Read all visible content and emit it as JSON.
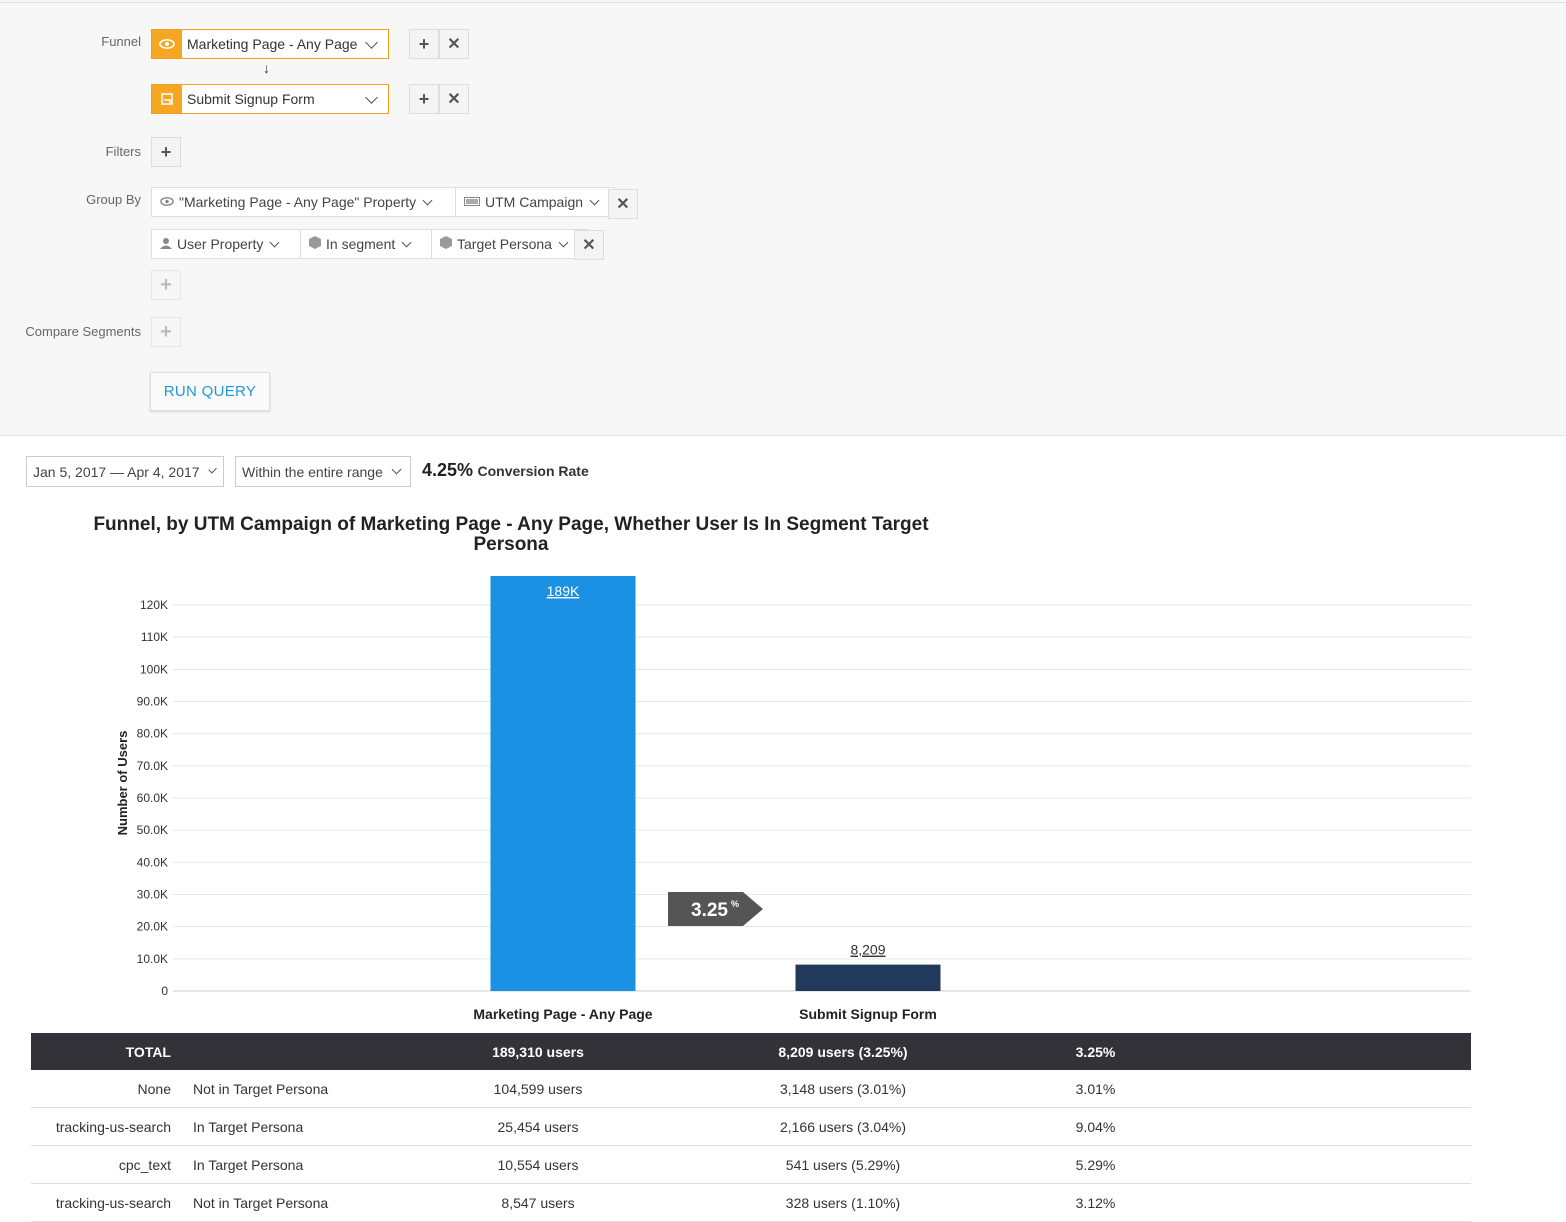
{
  "query": {
    "funnel_label": "Funnel",
    "steps": [
      {
        "label": "Marketing Page - Any Page",
        "icon": "eye-icon"
      },
      {
        "label": "Submit Signup Form",
        "icon": "form-icon"
      }
    ],
    "filters_label": "Filters",
    "group_by_label": "Group By",
    "group_by": [
      [
        {
          "label": "\"Marketing Page - Any Page\" Property",
          "icon": "eye-icon"
        },
        {
          "label": "UTM Campaign",
          "icon": "utm-icon"
        }
      ],
      [
        {
          "label": "User Property",
          "icon": "user-icon"
        },
        {
          "label": "In segment",
          "icon": "segment-icon"
        },
        {
          "label": "Target Persona",
          "icon": "segment-icon"
        }
      ]
    ],
    "compare_label": "Compare Segments",
    "run_label": "RUN QUERY"
  },
  "toolbar": {
    "date_range": "Jan 5, 2017 — Apr 4, 2017",
    "range_mode": "Within the entire range",
    "conversion_value": "4.25%",
    "conversion_label": "Conversion Rate"
  },
  "chart_data": {
    "type": "bar",
    "title": "Funnel, by UTM Campaign of Marketing Page - Any Page, Whether User Is In Segment Target Persona",
    "ylabel": "Number of Users",
    "categories": [
      "Marketing Page - Any Page",
      "Submit Signup Form"
    ],
    "values": [
      189310,
      8209
    ],
    "value_labels": [
      "189K",
      "8,209"
    ],
    "ylim": [
      0,
      120000
    ],
    "yticks": [
      "0",
      "10.0K",
      "20.0K",
      "30.0K",
      "40.0K",
      "50.0K",
      "60.0K",
      "70.0K",
      "80.0K",
      "90.0K",
      "100K",
      "110K",
      "120K"
    ],
    "step_conversion": "3.25",
    "step_conversion_unit": "%",
    "colors": [
      "#1a91e2",
      "#213a5c"
    ],
    "grid": true
  },
  "table": {
    "total": {
      "c1": "TOTAL",
      "c2": "",
      "c3": "189,310 users",
      "c4": "8,209 users (3.25%)",
      "c5": "3.25%"
    },
    "rows": [
      {
        "c1": "None",
        "c2": "Not in Target Persona",
        "c3": "104,599 users",
        "c4": "3,148 users (3.01%)",
        "c5": "3.01%"
      },
      {
        "c1": "tracking-us-search",
        "c2": "In Target Persona",
        "c3": "25,454 users",
        "c4": "2,166 users (3.04%)",
        "c5": "9.04%"
      },
      {
        "c1": "cpc_text",
        "c2": "In Target Persona",
        "c3": "10,554 users",
        "c4": "541 users (5.29%)",
        "c5": "5.29%"
      },
      {
        "c1": "tracking-us-search",
        "c2": "Not in Target Persona",
        "c3": "8,547 users",
        "c4": "328 users (1.10%)",
        "c5": "3.12%"
      }
    ]
  }
}
